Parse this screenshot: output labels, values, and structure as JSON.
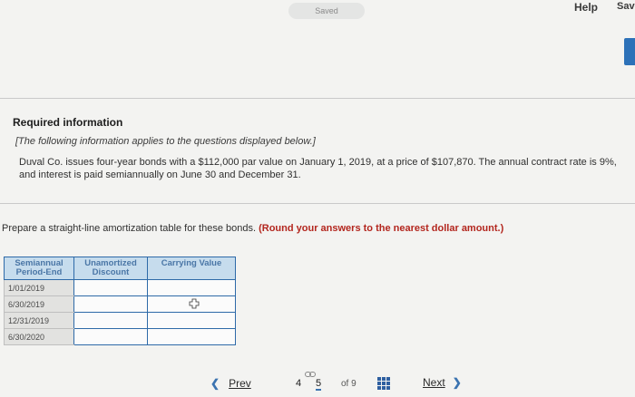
{
  "header": {
    "status": "Saved",
    "help_label": "Help",
    "save_label": "Sav"
  },
  "info": {
    "title": "Required information",
    "note": "[The following information applies to the questions displayed below.]",
    "body": "Duval Co. issues four-year bonds with a $112,000 par value on January 1, 2019, at a price of $107,870. The annual contract rate is 9%, and interest is paid semiannually on June 30 and December 31."
  },
  "question": {
    "prompt": "Prepare a straight-line amortization table for these bonds.",
    "emphasis": "(Round your answers to the nearest dollar amount.)"
  },
  "table": {
    "headers": [
      "Semiannual Period-End",
      "Unamortized Discount",
      "Carrying Value"
    ],
    "rows": [
      {
        "period": "1/01/2019",
        "discount": "",
        "carrying": ""
      },
      {
        "period": "6/30/2019",
        "discount": "",
        "carrying": ""
      },
      {
        "period": "12/31/2019",
        "discount": "",
        "carrying": ""
      },
      {
        "period": "6/30/2020",
        "discount": "",
        "carrying": ""
      }
    ]
  },
  "pagination": {
    "prev_label": "Prev",
    "next_label": "Next",
    "pages": [
      "4",
      "5"
    ],
    "current_page": "5",
    "of_label": "of 9"
  },
  "colors": {
    "accent": "#2c71b8",
    "table_header_bg": "#c6dced",
    "emphasis": "#b3261e"
  }
}
